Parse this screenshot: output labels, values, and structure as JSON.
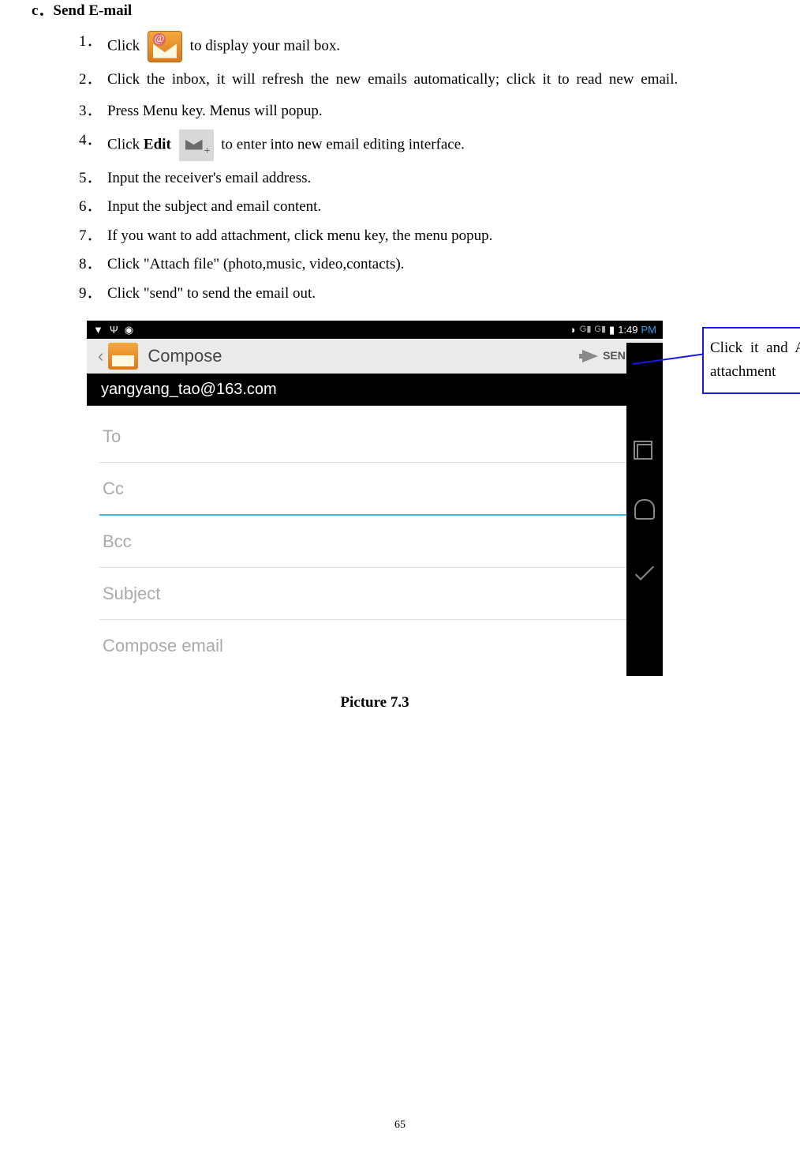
{
  "section_title": "c．Send E-mail",
  "steps": [
    {
      "num": "1．",
      "prefix": "Click ",
      "iconType": "mail",
      "suffix": " to display your mail box."
    },
    {
      "num": "2．",
      "text": "Click the inbox, it will refresh the new emails automatically; click it to read new email.",
      "justify": true
    },
    {
      "num": "3．",
      "text": "Press Menu key. Menus will popup."
    },
    {
      "num": "4．",
      "prefix": "Click ",
      "bold": "Edit",
      "iconType": "edit",
      "suffix": " to enter into new email editing interface."
    },
    {
      "num": "5．",
      "text": "Input the receiver's email address."
    },
    {
      "num": "6．",
      "text": "Input the subject and email content."
    },
    {
      "num": "7．",
      "text": "If you want to add attachment, click menu key, the menu popup."
    },
    {
      "num": "8．",
      "text": "Click \"Attach file\" (photo,music, video,contacts)."
    },
    {
      "num": "9．",
      "text": "Click \"send\" to send the email out."
    }
  ],
  "screenshot": {
    "status_time": "1:49",
    "status_pm": " PM",
    "signal1": "G",
    "signal2": "G",
    "app_title": "Compose",
    "send_label": "SEND",
    "from_email": "yangyang_tao@163.com",
    "field_to": "To",
    "field_cc": "Cc",
    "field_bcc": "Bcc",
    "field_subject": "Subject",
    "field_body": "Compose email"
  },
  "callout_text": "Click it and Add attachment",
  "caption": "Picture 7.3",
  "page_number": "65"
}
